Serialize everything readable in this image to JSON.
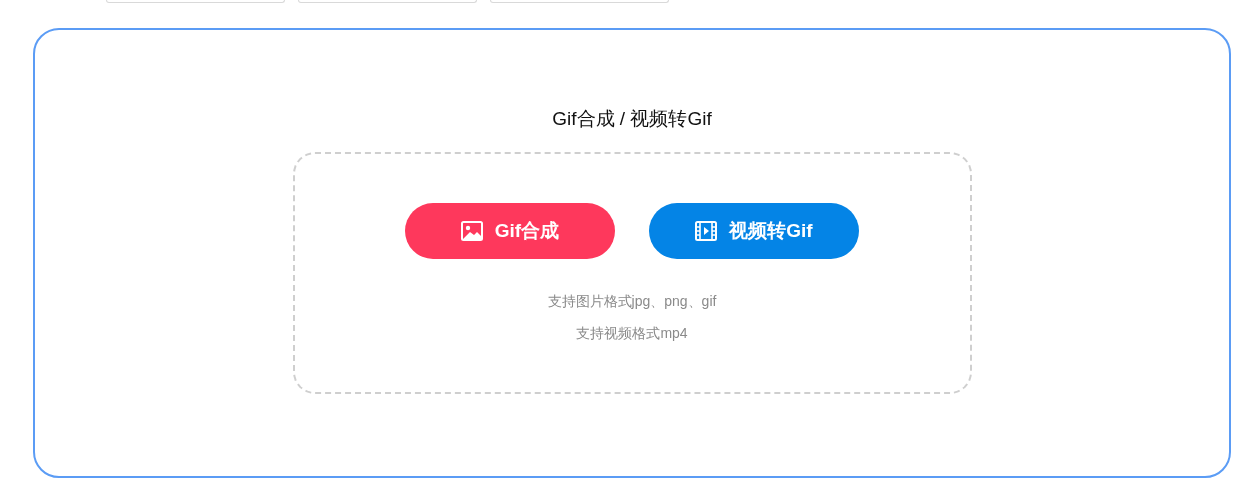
{
  "title": "Gif合成 / 视频转Gif",
  "buttons": [
    {
      "kind": "image",
      "label": "Gif合成"
    },
    {
      "kind": "video",
      "label": "视频转Gif"
    }
  ],
  "hints": [
    "支持图片格式jpg、png、gif",
    "支持视频格式mp4"
  ]
}
